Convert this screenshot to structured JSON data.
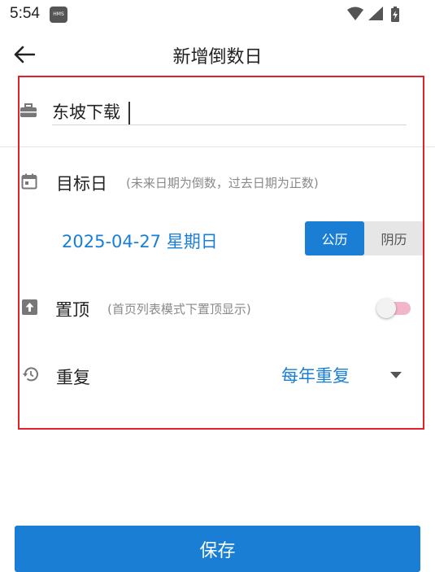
{
  "status_bar": {
    "time": "5:54",
    "badge": "HMS",
    "icons": [
      "wifi-icon",
      "signal-icon",
      "battery-charging-icon"
    ]
  },
  "app_bar": {
    "back_icon": "arrow-left-icon",
    "title": "新增倒数日"
  },
  "name_field": {
    "icon": "briefcase-icon",
    "value": "东坡下载"
  },
  "target_date": {
    "icon": "calendar-icon",
    "label": "目标日",
    "hint": "(未来日期为倒数，过去日期为正数)",
    "value": "2025-04-27 星期日",
    "calendar_options": [
      "公历",
      "阴历"
    ],
    "selected_calendar": "公历"
  },
  "pin_top": {
    "icon": "upload-arrow-icon",
    "label": "置顶",
    "hint": "(首页列表模式下置顶显示)",
    "enabled": false
  },
  "repeat": {
    "icon": "history-icon",
    "label": "重复",
    "value": "每年重复",
    "dropdown_icon": "caret-down-icon"
  },
  "save_button": {
    "label": "保存"
  },
  "colors": {
    "accent": "#1a7fd4",
    "highlight_border": "#e0202a",
    "switch_track_off": "#f3b6c8",
    "hint_text": "#8a8a8a"
  }
}
